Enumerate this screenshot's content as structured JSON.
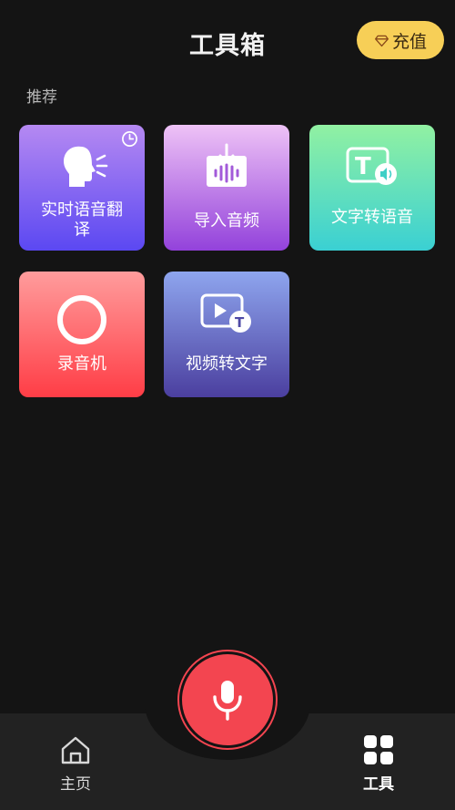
{
  "header": {
    "title": "工具箱",
    "recharge_label": "充值",
    "recharge_icon": "diamond-icon"
  },
  "section": {
    "label": "推荐"
  },
  "tools": [
    {
      "label_line1": "实时语音翻",
      "label_line2": "译",
      "icon": "speaking-head-icon",
      "badge_icon": "clock-icon"
    },
    {
      "label": "导入音频",
      "icon": "import-audio-icon"
    },
    {
      "label": "文字转语音",
      "icon": "text-to-speech-icon"
    },
    {
      "label": "录音机",
      "icon": "record-circle-icon"
    },
    {
      "label": "视频转文字",
      "icon": "video-to-text-icon"
    }
  ],
  "bottom_nav": {
    "home_label": "主页",
    "tools_label": "工具",
    "record_icon": "microphone-icon"
  },
  "colors": {
    "accent_yellow": "#f7cf57",
    "record_red": "#f34550"
  }
}
